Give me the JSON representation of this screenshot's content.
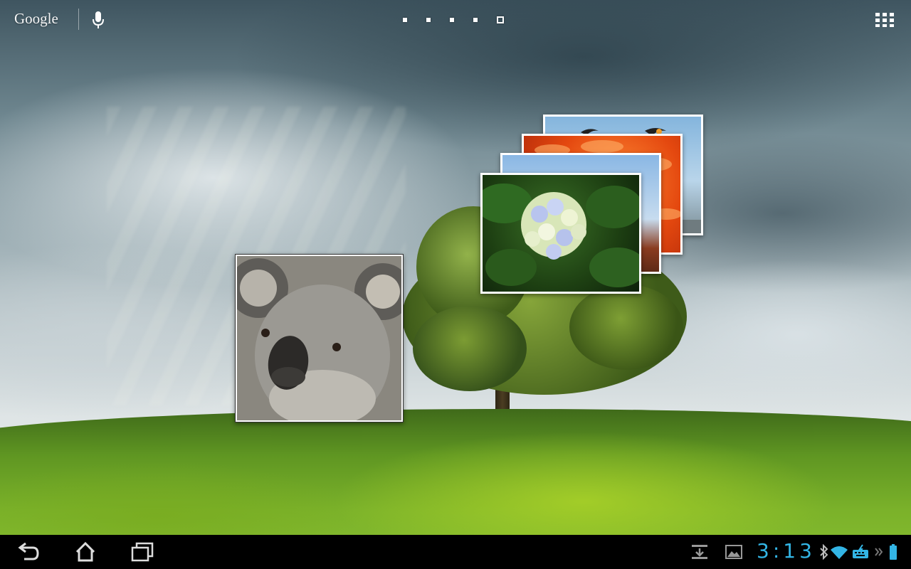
{
  "topbar": {
    "search_label": "Google",
    "mic_icon": "microphone-icon",
    "apps_icon": "app-grid-icon",
    "pages": {
      "count": 5,
      "current": 5
    }
  },
  "widget": {
    "photos": [
      {
        "subject": "koala"
      },
      {
        "subject": "hydrangea-flower"
      },
      {
        "subject": "landscape"
      },
      {
        "subject": "orange-flower"
      },
      {
        "subject": "birds-sky"
      }
    ]
  },
  "systembar": {
    "nav_icons": [
      "back-icon",
      "home-icon",
      "recent-apps-icon"
    ],
    "notification_icons": [
      "download-icon",
      "screenshot-icon"
    ],
    "clock": "3:13",
    "status_icons": [
      "bluetooth-icon",
      "wifi-icon",
      "keyboard-icon",
      "more-icon",
      "battery-icon"
    ],
    "accent_color": "#33b5e5"
  }
}
